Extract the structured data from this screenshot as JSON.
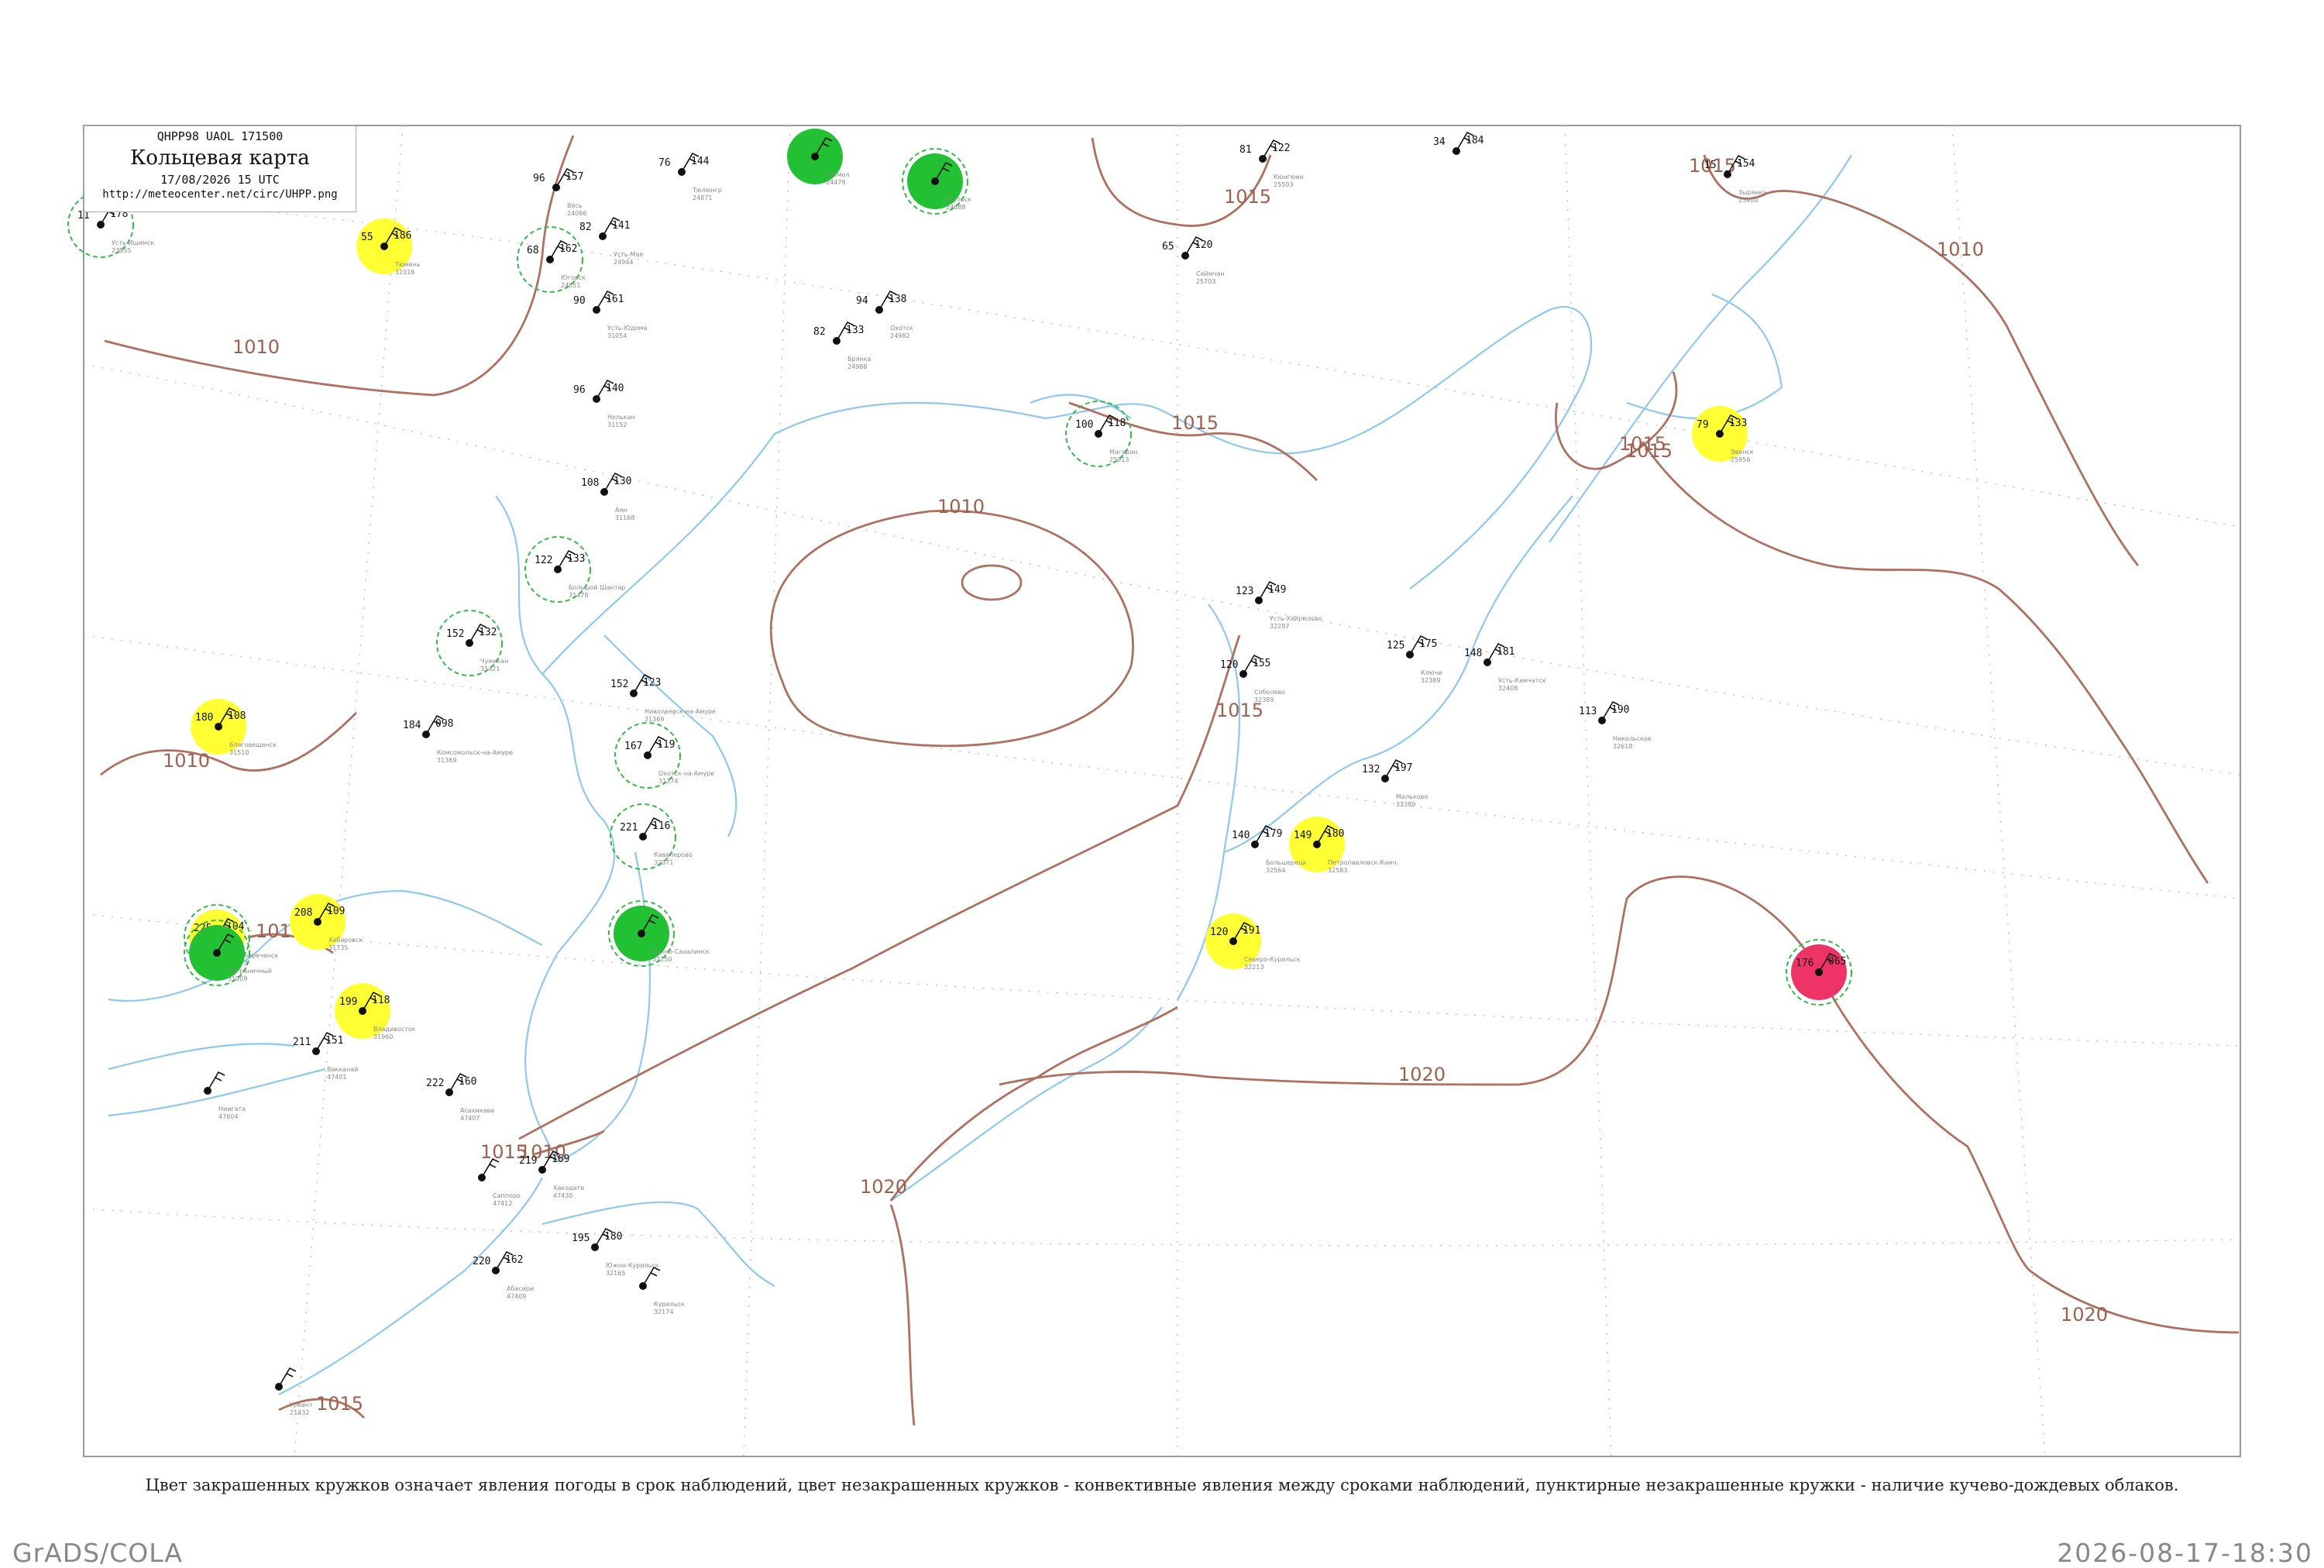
{
  "header": {
    "code_line": "QHPP98  UAOL  171500",
    "title": "Кольцевая карта",
    "date_line": "17/08/2026 15 UTC",
    "url": "http://meteocenter.net/circ/UHPP.png"
  },
  "footnote": "Цвет закрашенных кружков означает явления погоды в срок наблюдений, цвет незакрашенных кружков - конвективные явления между сроками наблюдений, пунктирные незакрашенные кружки - наличие кучево-дождевых облаков.",
  "footer": {
    "software": "GrADS/COLA",
    "timestamp": "2026-08-17-18:30"
  },
  "colors": {
    "isobar": "#b07060",
    "coast": "#8ec8f0",
    "green": "#22c033",
    "yellow": "#ffff33",
    "red": "#ee3366",
    "cb_dashed": "#33bb44"
  },
  "isobars": [
    {
      "label": "1010"
    },
    {
      "label": "1015"
    },
    {
      "label": "1015"
    },
    {
      "label": "1010"
    },
    {
      "label": "1015"
    },
    {
      "label": "1010"
    },
    {
      "label": "1015"
    },
    {
      "label": "1015"
    },
    {
      "label": "1010"
    },
    {
      "label": "1010"
    },
    {
      "label": "1010"
    },
    {
      "label": "1015"
    },
    {
      "label": "1020"
    },
    {
      "label": "1020"
    },
    {
      "label": "1020"
    },
    {
      "label": "1015"
    },
    {
      "label": "1015"
    }
  ],
  "stations": [
    {
      "name": "Усть-Ишимск",
      "id": "23955",
      "p": "178",
      "t": "11",
      "fill": "none",
      "cb": true
    },
    {
      "name": "Тюмень",
      "id": "31016",
      "p": "186",
      "t": "55",
      "fill": "yellow",
      "cb": false
    },
    {
      "name": "Вёсь",
      "id": "24066",
      "p": "157",
      "t": "96",
      "fill": "none",
      "cb": false
    },
    {
      "name": "Югорск",
      "id": "24851",
      "p": "162",
      "t": "68",
      "fill": "none",
      "cb": true
    },
    {
      "name": "Усть-Мая",
      "id": "24944",
      "p": "141",
      "t": "82",
      "fill": "none",
      "cb": false
    },
    {
      "name": "Тюлюнгр",
      "id": "24871",
      "p": "144",
      "t": "76",
      "fill": "none",
      "cb": false
    },
    {
      "name": "Токмол",
      "id": "24479",
      "p": "",
      "t": "",
      "fill": "green",
      "cb": false
    },
    {
      "name": "Угульск",
      "id": "24688",
      "p": "",
      "t": "",
      "fill": "green",
      "cb": true
    },
    {
      "name": "Кюнгюен",
      "id": "25503",
      "p": "122",
      "t": "81",
      "fill": "none",
      "cb": false
    },
    {
      "name": "",
      "id": "",
      "p": "184",
      "t": "34",
      "fill": "none",
      "cb": false
    },
    {
      "name": "Зырянка",
      "id": "25400",
      "p": "154",
      "t": "15",
      "fill": "none",
      "cb": false
    },
    {
      "name": "Сеймчан",
      "id": "25703",
      "p": "120",
      "t": "65",
      "fill": "none",
      "cb": false
    },
    {
      "name": "Нелькан",
      "id": "31152",
      "p": "140",
      "t": "96",
      "fill": "none",
      "cb": false
    },
    {
      "name": "Усть-Юдома",
      "id": "31054",
      "p": "161",
      "t": "90",
      "fill": "none",
      "cb": false
    },
    {
      "name": "Охотск",
      "id": "24982",
      "p": "138",
      "t": "94",
      "fill": "none",
      "cb": false
    },
    {
      "name": "Брянка",
      "id": "24988",
      "p": "133",
      "t": "82",
      "fill": "none",
      "cb": false
    },
    {
      "name": "Магадан",
      "id": "25913",
      "p": "118",
      "t": "100",
      "fill": "none",
      "cb": true
    },
    {
      "name": "Эвенск",
      "id": "25956",
      "p": "133",
      "t": "79",
      "fill": "yellow",
      "cb": false
    },
    {
      "name": "Аян",
      "id": "31168",
      "p": "130",
      "t": "108",
      "fill": "none",
      "cb": false
    },
    {
      "name": "Большой Шантар",
      "id": "31478",
      "p": "133",
      "t": "122",
      "fill": "none",
      "cb": true
    },
    {
      "name": "Усть-Хайрюзово",
      "id": "32287",
      "p": "149",
      "t": "123",
      "fill": "none",
      "cb": false
    },
    {
      "name": "Ключи",
      "id": "32389",
      "p": "175",
      "t": "125",
      "fill": "none",
      "cb": false
    },
    {
      "name": "Усть-Камчатск",
      "id": "32408",
      "p": "181",
      "t": "148",
      "fill": "none",
      "cb": false
    },
    {
      "name": "Никольское",
      "id": "32618",
      "p": "190",
      "t": "113",
      "fill": "none",
      "cb": false
    },
    {
      "name": "Соболево",
      "id": "32389",
      "p": "155",
      "t": "120",
      "fill": "none",
      "cb": false
    },
    {
      "name": "Мильково",
      "id": "32389",
      "p": "197",
      "t": "132",
      "fill": "none",
      "cb": false
    },
    {
      "name": "Петропавловск-Камч.",
      "id": "32583",
      "p": "180",
      "t": "149",
      "fill": "yellow",
      "cb": false
    },
    {
      "name": "Большерецк",
      "id": "32564",
      "p": "179",
      "t": "140",
      "fill": "none",
      "cb": false
    },
    {
      "name": "Северо-Курильск",
      "id": "32213",
      "p": "191",
      "t": "120",
      "fill": "yellow",
      "cb": false
    },
    {
      "name": "",
      "id": "",
      "p": "065",
      "t": "176",
      "fill": "red",
      "cb": true
    },
    {
      "name": "Николаевск-на-Амуре",
      "id": "31369",
      "p": "123",
      "t": "152",
      "fill": "none",
      "cb": false
    },
    {
      "name": "Охотск-на-Амуре",
      "id": "31374",
      "p": "119",
      "t": "167",
      "fill": "none",
      "cb": true
    },
    {
      "name": "Кавалерово",
      "id": "32071",
      "p": "116",
      "t": "221",
      "fill": "none",
      "cb": true
    },
    {
      "name": "Южно-Сахалинск",
      "id": "32150",
      "p": "",
      "t": "",
      "fill": "green",
      "cb": true
    },
    {
      "name": "Чумикан",
      "id": "31421",
      "p": "132",
      "t": "152",
      "fill": "none",
      "cb": true
    },
    {
      "name": "Комсомольск-на-Амуре",
      "id": "31369",
      "p": "098",
      "t": "184",
      "fill": "none",
      "cb": false
    },
    {
      "name": "Благовещенск",
      "id": "31510",
      "p": "108",
      "t": "180",
      "fill": "yellow",
      "cb": false
    },
    {
      "name": "Хабаровск",
      "id": "31735",
      "p": "109",
      "t": "208",
      "fill": "yellow",
      "cb": false
    },
    {
      "name": "Дальнереченск",
      "id": "31873",
      "p": "104",
      "t": "225",
      "fill": "yellow",
      "cb": true
    },
    {
      "name": "Пограничный",
      "id": "31909",
      "p": "",
      "t": "",
      "fill": "green",
      "cb": true
    },
    {
      "name": "Владивосток",
      "id": "31960",
      "p": "118",
      "t": "199",
      "fill": "yellow",
      "cb": false
    },
    {
      "name": "Ниигата",
      "id": "47604",
      "p": "",
      "t": "",
      "fill": "none",
      "cb": false
    },
    {
      "name": "Вакканай",
      "id": "47401",
      "p": "151",
      "t": "211",
      "fill": "none",
      "cb": false
    },
    {
      "name": "Асахикава",
      "id": "47407",
      "p": "160",
      "t": "222",
      "fill": "none",
      "cb": false
    },
    {
      "name": "Саппоро",
      "id": "47412",
      "p": "",
      "t": "",
      "fill": "none",
      "cb": false
    },
    {
      "name": "Хакодате",
      "id": "47430",
      "p": "169",
      "t": "219",
      "fill": "none",
      "cb": false
    },
    {
      "name": "Абасири",
      "id": "47409",
      "p": "162",
      "t": "220",
      "fill": "none",
      "cb": false
    },
    {
      "name": "Южно-Курильск",
      "id": "32165",
      "p": "180",
      "t": "195",
      "fill": "none",
      "cb": false
    },
    {
      "name": "Курильск",
      "id": "32174",
      "p": "",
      "t": "",
      "fill": "none",
      "cb": false
    },
    {
      "name": "Урбант",
      "id": "21432",
      "p": "",
      "t": "",
      "fill": "none",
      "cb": false
    }
  ]
}
